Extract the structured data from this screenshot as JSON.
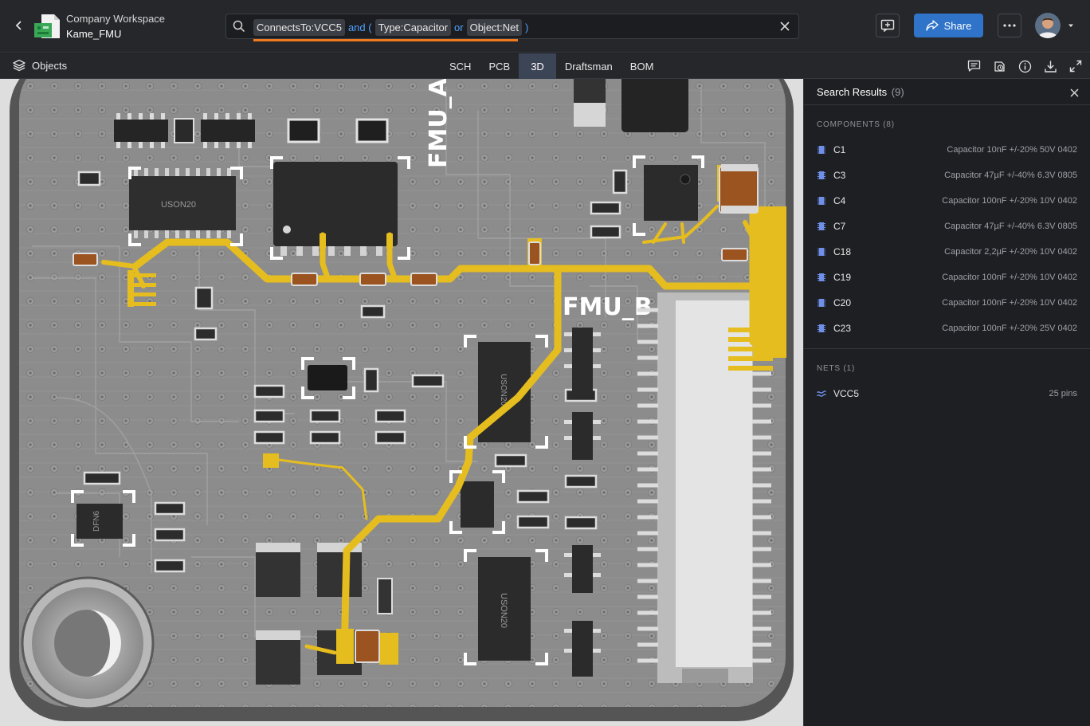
{
  "header": {
    "workspace": "Company Workspace",
    "project": "Kame_FMU",
    "share_label": "Share"
  },
  "search": {
    "chips": [
      "ConnectsTo:VCC5",
      "Type:Capacitor",
      "Object:Net"
    ],
    "op_and": "and (",
    "op_or": "or",
    "op_close": ")"
  },
  "viewbar": {
    "objects_label": "Objects",
    "tabs": [
      "SCH",
      "PCB",
      "3D",
      "Draftsman",
      "BOM"
    ],
    "active_tab": "3D"
  },
  "board": {
    "labels": [
      "FMU_A",
      "FMU_B"
    ],
    "chip_labels": [
      "USON20",
      "USON20",
      "USON20",
      "DFN6"
    ]
  },
  "results": {
    "title": "Search Results",
    "count": "(9)",
    "components_title": "COMPONENTS (8)",
    "components": [
      {
        "name": "C1",
        "desc": "Capacitor 10nF +/-20% 50V 0402"
      },
      {
        "name": "C3",
        "desc": "Capacitor 47µF +/-40% 6.3V 0805"
      },
      {
        "name": "C4",
        "desc": "Capacitor 100nF +/-20% 10V 0402"
      },
      {
        "name": "C7",
        "desc": "Capacitor 47µF +/-40% 6.3V 0805"
      },
      {
        "name": "C18",
        "desc": "Capacitor 2,2µF +/-20% 10V 0402"
      },
      {
        "name": "C19",
        "desc": "Capacitor 100nF +/-20% 10V 0402"
      },
      {
        "name": "C20",
        "desc": "Capacitor 100nF +/-20% 10V 0402"
      },
      {
        "name": "C23",
        "desc": "Capacitor 100nF +/-20% 25V 0402"
      }
    ],
    "nets_title": "NETS (1)",
    "nets": [
      {
        "name": "VCC5",
        "desc": "25 pins"
      }
    ]
  },
  "colors": {
    "accent": "#2f74c9",
    "query_op": "#4ea1ff",
    "query_underline": "#f07a1e",
    "trace": "#e6bd1e",
    "board": "#8c8c8c"
  }
}
